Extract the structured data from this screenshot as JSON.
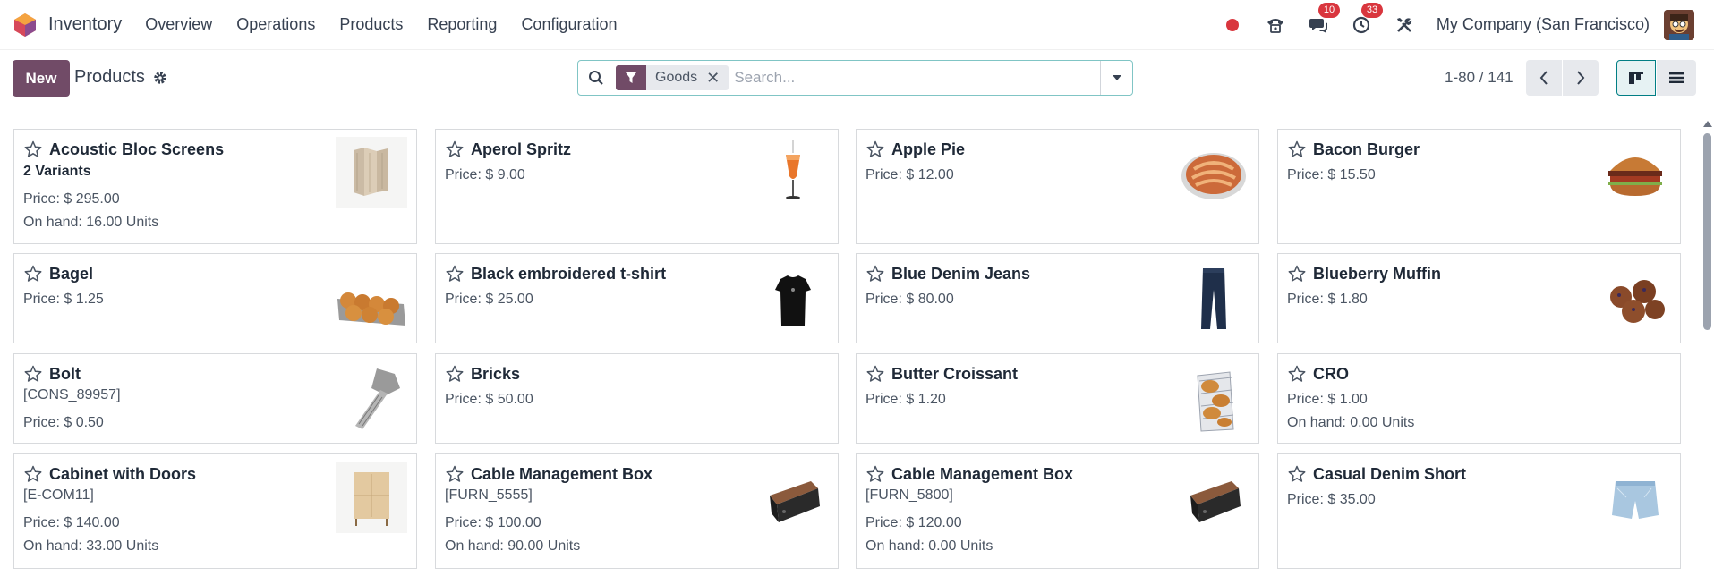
{
  "navbar": {
    "app_name": "Inventory",
    "menu": [
      "Overview",
      "Operations",
      "Products",
      "Reporting",
      "Configuration"
    ],
    "messages_badge": "10",
    "activities_badge": "33",
    "company": "My Company (San Francisco)"
  },
  "control": {
    "new_label": "New",
    "breadcrumb": "Products",
    "facet_label": "Goods",
    "search_placeholder": "Search...",
    "pager": "1-80 / 141"
  },
  "colors": {
    "brand": "#714b67",
    "accent": "#017e84",
    "badge": "#d9363e"
  },
  "products": [
    {
      "name": "Acoustic Bloc Screens",
      "variants": "2 Variants",
      "price": "Price: $ 295.00",
      "onhand": "On hand: 16.00 Units",
      "image": "panel-screen"
    },
    {
      "name": "Aperol Spritz",
      "price": "Price: $ 9.00",
      "image": "cocktail-glass"
    },
    {
      "name": "Apple Pie",
      "price": "Price: $ 12.00",
      "image": "pie"
    },
    {
      "name": "Bacon Burger",
      "price": "Price: $ 15.50",
      "image": "burger"
    },
    {
      "name": "Bagel",
      "price": "Price: $ 1.25",
      "image": "bagels"
    },
    {
      "name": "Black embroidered t-shirt",
      "price": "Price: $ 25.00",
      "image": "tshirt"
    },
    {
      "name": "Blue Denim Jeans",
      "price": "Price: $ 80.00",
      "image": "jeans"
    },
    {
      "name": "Blueberry Muffin",
      "price": "Price: $ 1.80",
      "image": "muffins"
    },
    {
      "name": "Bolt",
      "ref": "[CONS_89957]",
      "price": "Price: $ 0.50",
      "image": "bolt"
    },
    {
      "name": "Bricks",
      "price": "Price: $ 50.00"
    },
    {
      "name": "Butter Croissant",
      "price": "Price: $ 1.20",
      "image": "croissants"
    },
    {
      "name": "CRO",
      "price": "Price: $ 1.00",
      "onhand": "On hand: 0.00 Units"
    },
    {
      "name": "Cabinet with Doors",
      "ref": "[E-COM11]",
      "price": "Price: $ 140.00",
      "onhand": "On hand: 33.00 Units",
      "image": "cabinet"
    },
    {
      "name": "Cable Management Box",
      "ref": "[FURN_5555]",
      "price": "Price: $ 100.00",
      "onhand": "On hand: 90.00 Units",
      "image": "cable-box"
    },
    {
      "name": "Cable Management Box",
      "ref": "[FURN_5800]",
      "price": "Price: $ 120.00",
      "onhand": "On hand: 0.00 Units",
      "image": "cable-box"
    },
    {
      "name": "Casual Denim Short",
      "price": "Price: $ 35.00",
      "image": "shorts"
    }
  ]
}
